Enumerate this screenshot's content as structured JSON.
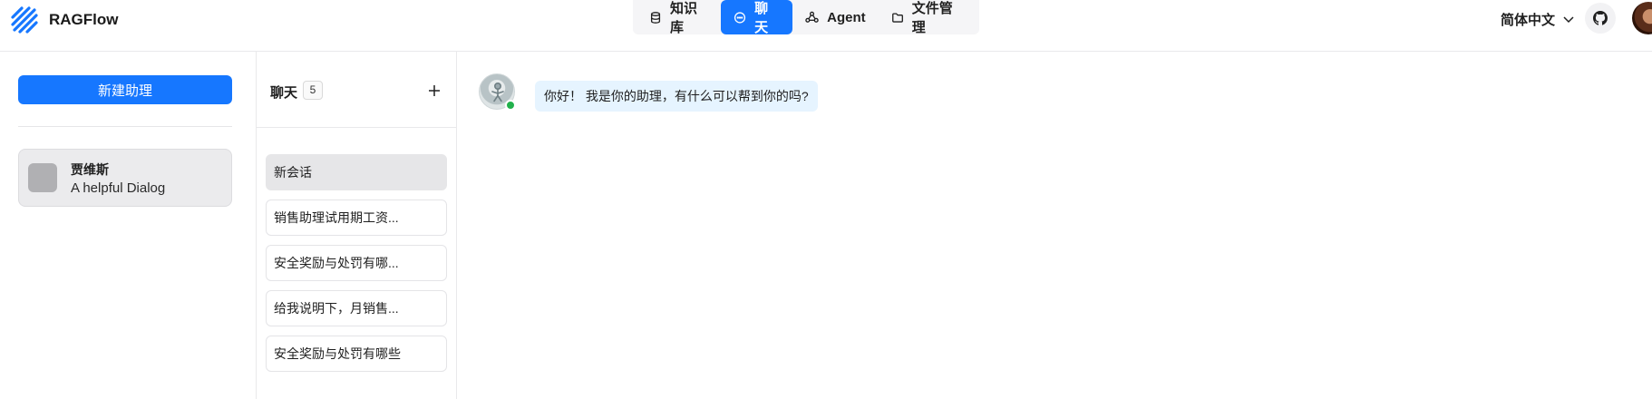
{
  "app": {
    "name": "RAGFlow"
  },
  "nav": {
    "items": [
      {
        "label": "知识库",
        "icon": "database-icon",
        "active": false
      },
      {
        "label": "聊天",
        "icon": "chat-bubble-icon",
        "active": true
      },
      {
        "label": "Agent",
        "icon": "graph-icon",
        "active": false
      },
      {
        "label": "文件管理",
        "icon": "folder-icon",
        "active": false
      }
    ]
  },
  "header": {
    "language": "简体中文"
  },
  "assistants": {
    "new_button_label": "新建助理",
    "items": [
      {
        "name": "贾维斯",
        "description": "A helpful Dialog"
      }
    ]
  },
  "conversations": {
    "title": "聊天",
    "count": "5",
    "items": [
      {
        "label": "新会话",
        "active": true
      },
      {
        "label": "销售助理试用期工资...",
        "active": false
      },
      {
        "label": "安全奖励与处罚有哪...",
        "active": false
      },
      {
        "label": "给我说明下，月销售...",
        "active": false
      },
      {
        "label": "安全奖励与处罚有哪些",
        "active": false
      }
    ]
  },
  "chat": {
    "messages": [
      {
        "role": "assistant",
        "text": "你好！ 我是你的助理，有什么可以帮到你的吗?"
      }
    ]
  },
  "colors": {
    "accent": "#1677ff",
    "online": "#22b14c",
    "bubble": "#e6f4ff"
  }
}
